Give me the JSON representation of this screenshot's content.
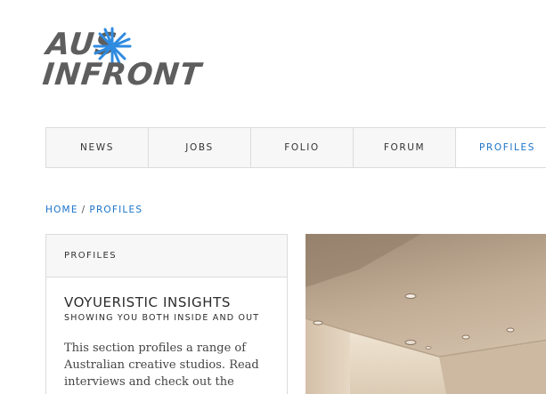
{
  "logo": {
    "line1": "AUS",
    "line2": "INFRONT",
    "text_color": "#5e5e5e",
    "star_color": "#2f8be0",
    "star_icon": "asterisk-star-icon"
  },
  "nav": {
    "items": [
      {
        "label": "NEWS",
        "active": false
      },
      {
        "label": "JOBS",
        "active": false
      },
      {
        "label": "FOLIO",
        "active": false
      },
      {
        "label": "FORUM",
        "active": false
      },
      {
        "label": "PROFILES",
        "active": true
      }
    ]
  },
  "breadcrumb": {
    "home": "HOME",
    "separator": "/",
    "current": "PROFILES"
  },
  "panel": {
    "header": "PROFILES",
    "title": "VOYUERISTIC INSIGHTS",
    "subtitle": "SHOWING YOU BOTH INSIDE AND OUT",
    "body": "This section profiles a range of Australian creative studios. Read interviews and check out the"
  },
  "hero": {
    "image_description_icon": "studio-interior-photo"
  },
  "colors": {
    "accent": "#1a73c8",
    "border": "#dcdcdc",
    "nav_bg": "#f7f7f7"
  }
}
